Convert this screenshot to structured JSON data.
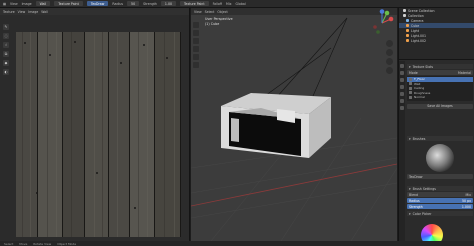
{
  "topbar": {
    "mode": "Texture Paint",
    "view_menu": "View",
    "image_menu": "Image",
    "image_name": "Wall",
    "viewport_mode": "Texture Paint",
    "brush_label": "TexDraw",
    "radius_label": "Radius",
    "strength_label": "Strength",
    "falloff_label": "Falloff",
    "blend_label": "Mix",
    "global_label": "Global"
  },
  "image_editor": {
    "header_items": [
      "Texture",
      "View",
      "Image",
      "Wall"
    ],
    "tools": [
      "draw",
      "soften",
      "smear",
      "clone",
      "fill",
      "mask"
    ]
  },
  "viewport": {
    "view_name": "User Perspective",
    "object_label": "(1) Cube",
    "menus": [
      "View",
      "Select",
      "Object"
    ],
    "gizmo_axes": [
      "X",
      "Y",
      "Z"
    ]
  },
  "outliner": {
    "title": "Scene Collection",
    "items": [
      {
        "label": "Scene Collection",
        "color": "#cfcfcf"
      },
      {
        "label": "Collection",
        "color": "#cfcfcf"
      },
      {
        "label": "Camera",
        "color": "#7fb3e6"
      },
      {
        "label": "Cube",
        "color": "#f0a04b"
      },
      {
        "label": "Light",
        "color": "#f0a04b"
      },
      {
        "label": "Light.001",
        "color": "#f0a04b"
      },
      {
        "label": "Light.002",
        "color": "#f0a04b"
      }
    ]
  },
  "properties": {
    "texture_slots_title": "Texture Slots",
    "mode_label": "Mode",
    "mode_value": "Material",
    "slots": [
      "T_Floor",
      "Wall",
      "Ceiling",
      "Roughness",
      "Normal"
    ],
    "save_button": "Save All Images",
    "brushes_title": "Brushes",
    "brush_name": "TexDraw",
    "brush_settings_title": "Brush Settings",
    "blend_label": "Blend",
    "blend_value": "Mix",
    "radius_label": "Radius",
    "radius_value": "50 px",
    "strength_label": "Strength",
    "strength_value": "1.000",
    "color_picker_title": "Color Picker",
    "color_value": "#ffffff"
  },
  "statusbar": {
    "items": [
      "Select",
      "Move",
      "Rotate View",
      "Object Mode"
    ]
  }
}
